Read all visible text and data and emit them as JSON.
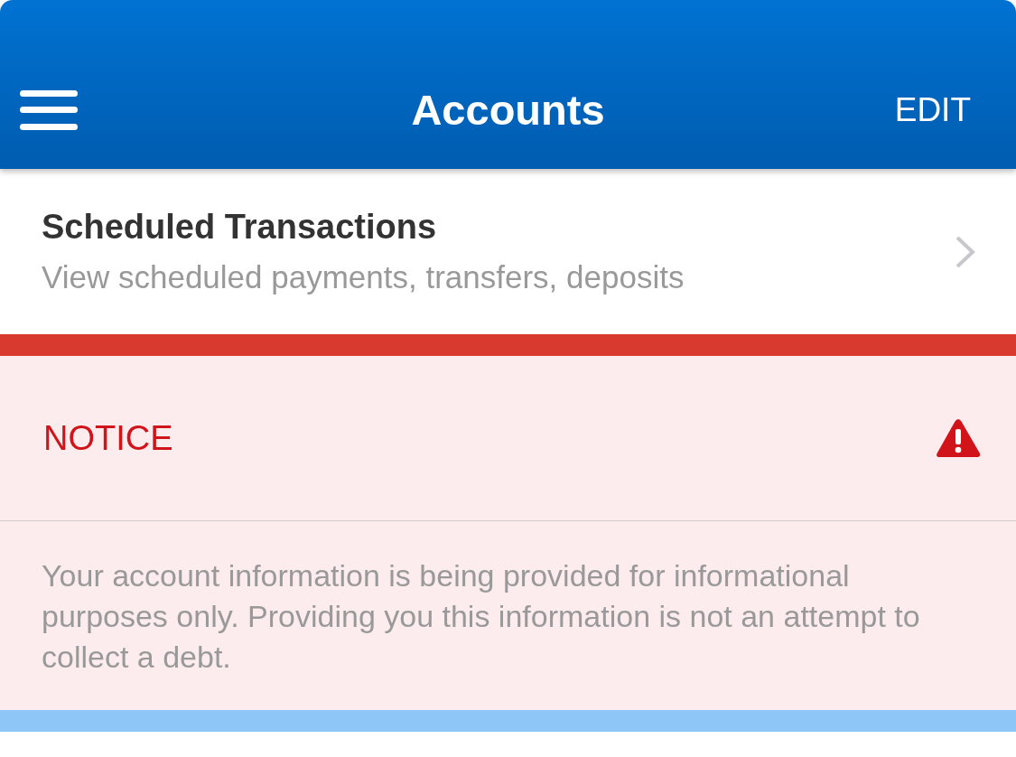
{
  "header": {
    "title": "Accounts",
    "action": "EDIT"
  },
  "scheduled": {
    "title": "Scheduled Transactions",
    "subtitle": "View scheduled payments, transfers, deposits"
  },
  "notice": {
    "title": "NOTICE",
    "message": "Your account information is being provided for informational purposes only. Providing you this information is not an attempt to collect a debt."
  }
}
